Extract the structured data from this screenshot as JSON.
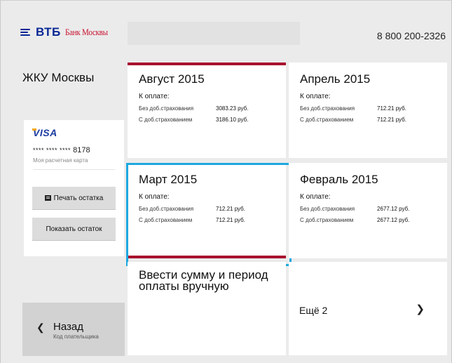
{
  "header": {
    "logo_vtb": "ВТБ",
    "logo_bank": "Банк Москвы",
    "phone": "8 800 200-2326"
  },
  "sidebar": {
    "title": "ЖКУ Москвы",
    "card": {
      "brand": "VISA",
      "number_mask": "**** **** ****",
      "number_last": "8178",
      "subtitle": "Моя расчетная карта"
    },
    "print_button": "Печать остатка",
    "show_button": "Показать остаток",
    "back": {
      "label": "Назад",
      "sub": "Код плательщика"
    }
  },
  "tiles": [
    {
      "title": "Август 2015",
      "pay_label": "К оплате:",
      "rows": [
        {
          "k": "Без доб.страхования",
          "v": "3083.23 руб."
        },
        {
          "k": "С доб.страхованием",
          "v": "3186.10 руб."
        }
      ]
    },
    {
      "title": "Апрель 2015",
      "pay_label": "К оплате:",
      "rows": [
        {
          "k": "Без доб.страхования",
          "v": "712.21 руб."
        },
        {
          "k": "С доб.страхованием",
          "v": "712.21 руб."
        }
      ]
    },
    {
      "title": "Март 2015",
      "pay_label": "К оплате:",
      "rows": [
        {
          "k": "Без доб.страхования",
          "v": "712.21 руб."
        },
        {
          "k": "С доб.страхованием",
          "v": "712.21 руб."
        }
      ]
    },
    {
      "title": "Февраль 2015",
      "pay_label": "К оплате:",
      "rows": [
        {
          "k": "Без доб.страхования",
          "v": "2677.12 руб."
        },
        {
          "k": "С доб.страхованием",
          "v": "2677.12 руб."
        }
      ]
    },
    {
      "title": "Ввести сумму и период оплаты вручную"
    },
    {
      "title": "Ещё 2"
    }
  ],
  "colors": {
    "accent_red": "#a8122e",
    "selection_blue": "#1ea8e0",
    "brand_blue": "#0a2896"
  }
}
